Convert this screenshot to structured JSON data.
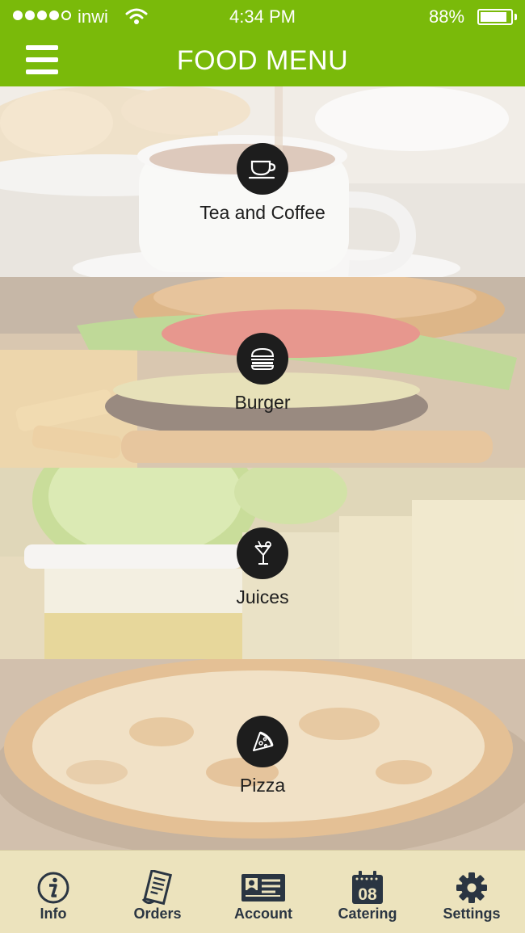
{
  "status_bar": {
    "carrier": "inwi",
    "time": "4:34 PM",
    "battery_percent": "88%",
    "battery_level": 0.88,
    "signal_bars": 4,
    "signal_max": 5
  },
  "header": {
    "title": "FOOD MENU",
    "accent_color": "#7aba0a"
  },
  "categories": [
    {
      "label": "Tea and Coffee",
      "icon": "coffee-cup-icon"
    },
    {
      "label": "Burger",
      "icon": "burger-icon"
    },
    {
      "label": "Juices",
      "icon": "cocktail-icon"
    },
    {
      "label": "Pizza",
      "icon": "pizza-slice-icon"
    }
  ],
  "tab_bar": {
    "background": "#ece3bd",
    "items": [
      {
        "label": "Info",
        "icon": "info-icon"
      },
      {
        "label": "Orders",
        "icon": "receipt-icon"
      },
      {
        "label": "Account",
        "icon": "id-card-icon"
      },
      {
        "label": "Catering",
        "icon": "calendar-icon",
        "icon_text": "08"
      },
      {
        "label": "Settings",
        "icon": "gear-icon"
      }
    ]
  }
}
